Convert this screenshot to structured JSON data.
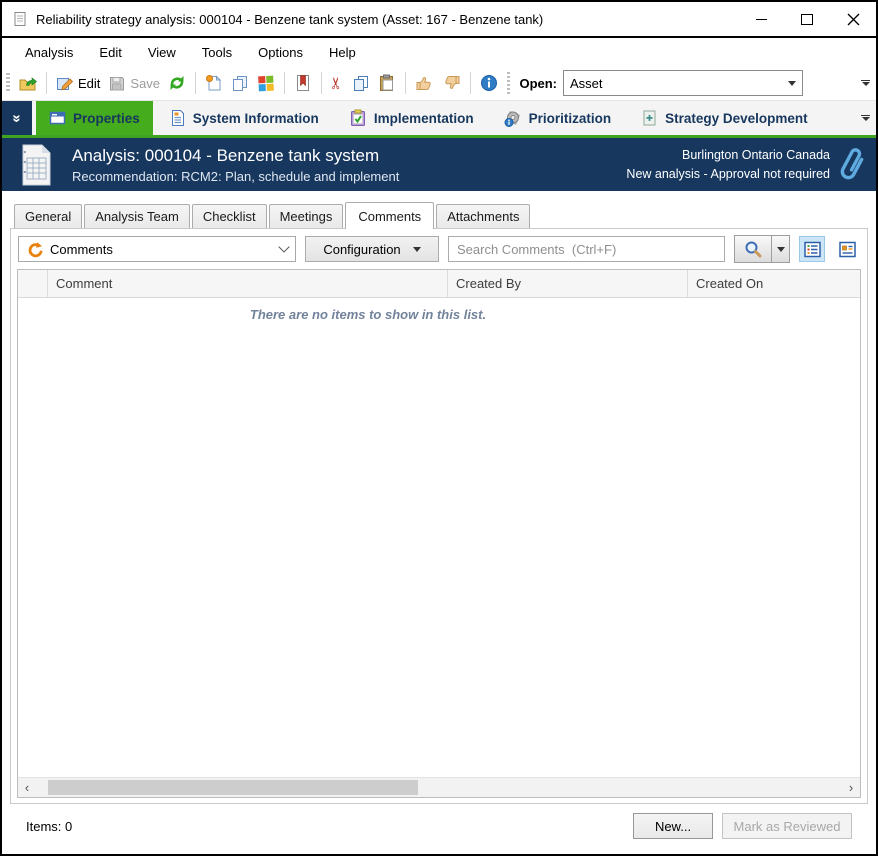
{
  "window": {
    "title": "Reliability strategy analysis: 000104 - Benzene tank system (Asset: 167 - Benzene tank)"
  },
  "menu": {
    "items": [
      "Analysis",
      "Edit",
      "View",
      "Tools",
      "Options",
      "Help"
    ]
  },
  "toolbar": {
    "edit_label": "Edit",
    "save_label": "Save",
    "open_label": "Open:",
    "open_value": "Asset",
    "icons": [
      "open-item-icon",
      "edit-icon",
      "save-icon",
      "refresh-icon",
      "new-item-icon",
      "copy-item-icon",
      "windows-icon",
      "report-icon",
      "cut-icon",
      "copy-icon",
      "paste-icon",
      "thumbs-up-icon",
      "thumbs-down-icon",
      "info-icon",
      "toolbar-overflow-icon"
    ]
  },
  "ribbon": {
    "tabs": [
      "Properties",
      "System Information",
      "Implementation",
      "Prioritization",
      "Strategy Development"
    ],
    "selected": "Properties"
  },
  "banner": {
    "title": "Analysis: 000104 - Benzene tank system",
    "subtitle": "Recommendation: RCM2: Plan, schedule and implement",
    "location": "Burlington Ontario Canada",
    "approval_status": "New analysis - Approval not required"
  },
  "subtabs": {
    "items": [
      "General",
      "Analysis Team",
      "Checklist",
      "Meetings",
      "Comments",
      "Attachments"
    ],
    "selected": "Comments"
  },
  "comments_panel": {
    "view_selector_value": "Comments",
    "configuration_label": "Configuration",
    "search_placeholder": "Search Comments  (Ctrl+F)"
  },
  "list": {
    "columns": [
      "Comment",
      "Created By",
      "Created On"
    ],
    "rows": [],
    "empty_message": "There are no items to show in this list."
  },
  "status_bar": {
    "items_count_label": "Items: 0",
    "new_button_label": "New...",
    "mark_reviewed_label": "Mark as Reviewed"
  },
  "colors": {
    "accent_green": "#44ac1d",
    "header_navy": "#17375e",
    "selection_blue": "#cde6f7",
    "swirl_orange": "#e8820c",
    "paperclip_blue": "#5fabdf"
  }
}
